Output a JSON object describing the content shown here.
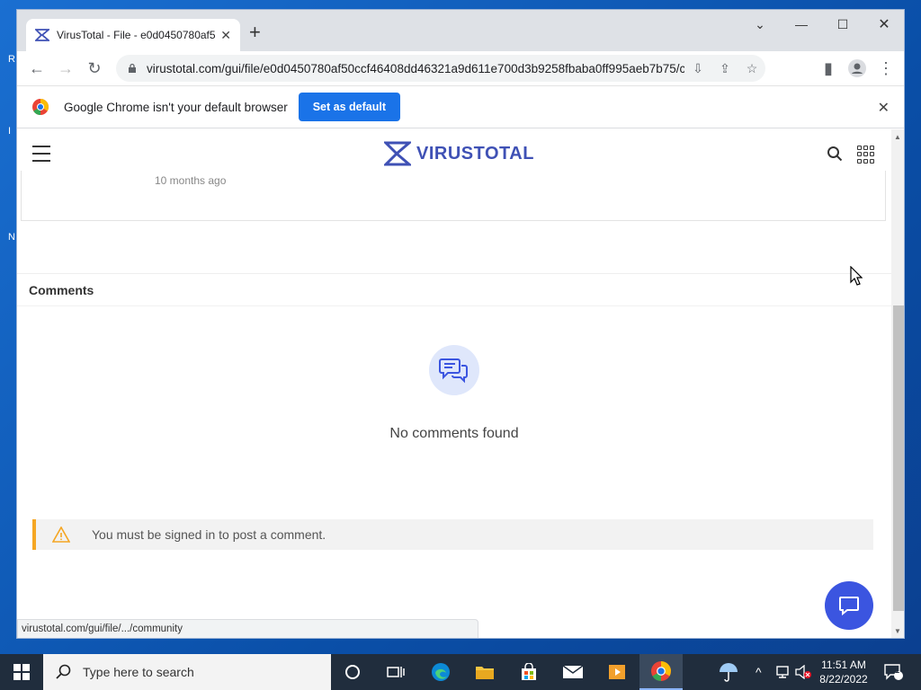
{
  "browser": {
    "tab_title": "VirusTotal - File - e0d0450780af5",
    "url": "virustotal.com/gui/file/e0d0450780af50ccf46408dd46321a9d611e700d3b9258fbaba0ff995aeb7b75/c...",
    "infobar_message": "Google Chrome isn't your default browser",
    "set_default_label": "Set as default",
    "status_url": "virustotal.com/gui/file/.../community"
  },
  "page": {
    "logo_text": "VIRUSTOTAL",
    "partial_text": "10 months ago",
    "comments_heading": "Comments",
    "no_comments": "No comments found",
    "signin_warning": "You must be signed in to post a comment."
  },
  "taskbar": {
    "search_placeholder": "Type here to search",
    "time": "11:51 AM",
    "date": "8/22/2022",
    "notification_count": "1"
  },
  "colors": {
    "accent": "#1a73e8",
    "vt_blue": "#3f51b5",
    "warning": "#f5a623",
    "chat_button": "#3b55e0"
  }
}
